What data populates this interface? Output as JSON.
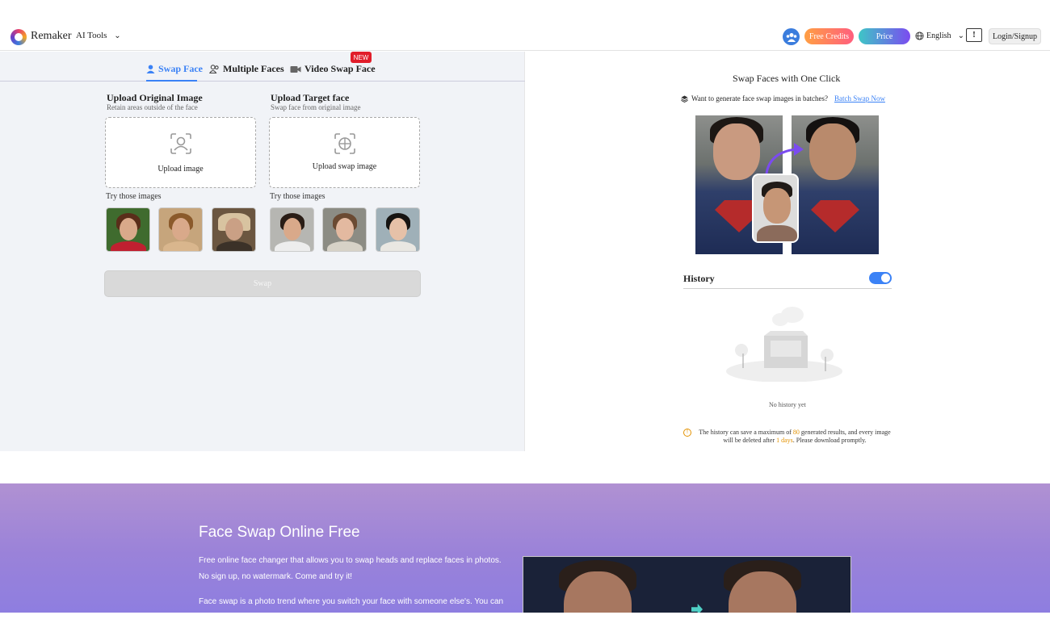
{
  "header": {
    "brand": "Remaker",
    "ai_tools": "AI Tools",
    "free_credits": "Free Credits",
    "price": "Price",
    "language": "English",
    "login": "Login/Signup",
    "colors": {
      "accent": "#3b82f6",
      "credits_from": "#ff9f43",
      "credits_to": "#ff5e7e",
      "price_from": "#3ec6c6",
      "price_to": "#7b4bf0"
    }
  },
  "tabs": [
    {
      "label": "Swap Face",
      "icon": "user-icon",
      "active": true
    },
    {
      "label": "Multiple Faces",
      "icon": "users-icon",
      "active": false
    },
    {
      "label": "Video Swap Face",
      "icon": "video-icon",
      "active": false,
      "badge": "NEW"
    }
  ],
  "upload": {
    "original": {
      "title": "Upload Original Image",
      "subtitle": "Retain areas outside of the face",
      "button": "Upload image",
      "try_label": "Try those images"
    },
    "target": {
      "title": "Upload Target face",
      "subtitle": "Swap face from original image",
      "button": "Upload swap image",
      "try_label": "Try those images"
    }
  },
  "swap_button": "Swap",
  "right": {
    "title": "Swap Faces with One Click",
    "batch_prompt": "Want to generate face swap images in batches?",
    "batch_link": "Batch Swap Now",
    "history_title": "History",
    "history_enabled": true,
    "no_history": "No history yet",
    "info_pre": "The history can save a maximum of ",
    "info_max": "80",
    "info_mid": " generated results, and every image will be deleted after ",
    "info_days": "1 days",
    "info_post": ". Please download promptly."
  },
  "banner": {
    "title": "Face Swap Online Free",
    "p1": "Free online face changer that allows you to swap heads and replace faces in photos. No sign up, no watermark. Come and try it!",
    "p2": "Face swap is a photo trend where you switch your face with someone else's. You can use"
  }
}
